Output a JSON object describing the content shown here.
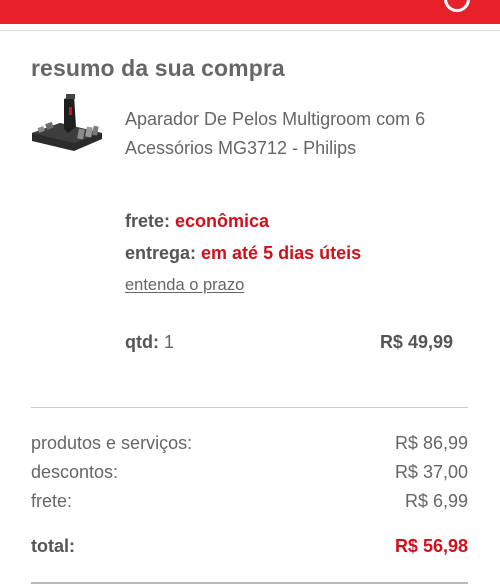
{
  "summary": {
    "title": "resumo da sua compra"
  },
  "product": {
    "name": "Aparador De Pelos Multigroom com 6 Acessórios MG3712 - Philips",
    "image_icon": "trimmer-product-image"
  },
  "shipping": {
    "frete_label": "frete:",
    "frete_value": "econômica",
    "entrega_label": "entrega:",
    "entrega_value": "em até 5 dias úteis",
    "prazo_link": "entenda o prazo"
  },
  "item": {
    "qtd_label": "qtd:",
    "qtd_value": "1",
    "price": "R$ 49,99"
  },
  "totals": {
    "produtos_label": "produtos e serviços:",
    "produtos_value": "R$ 86,99",
    "descontos_label": "descontos:",
    "descontos_value": "R$ 37,00",
    "frete_label": "frete:",
    "frete_value": "R$ 6,99",
    "total_label": "total:",
    "total_value": "R$ 56,98"
  },
  "colors": {
    "brand_red": "#e8202a",
    "highlight_red": "#d0101c",
    "text_gray": "#666666"
  }
}
